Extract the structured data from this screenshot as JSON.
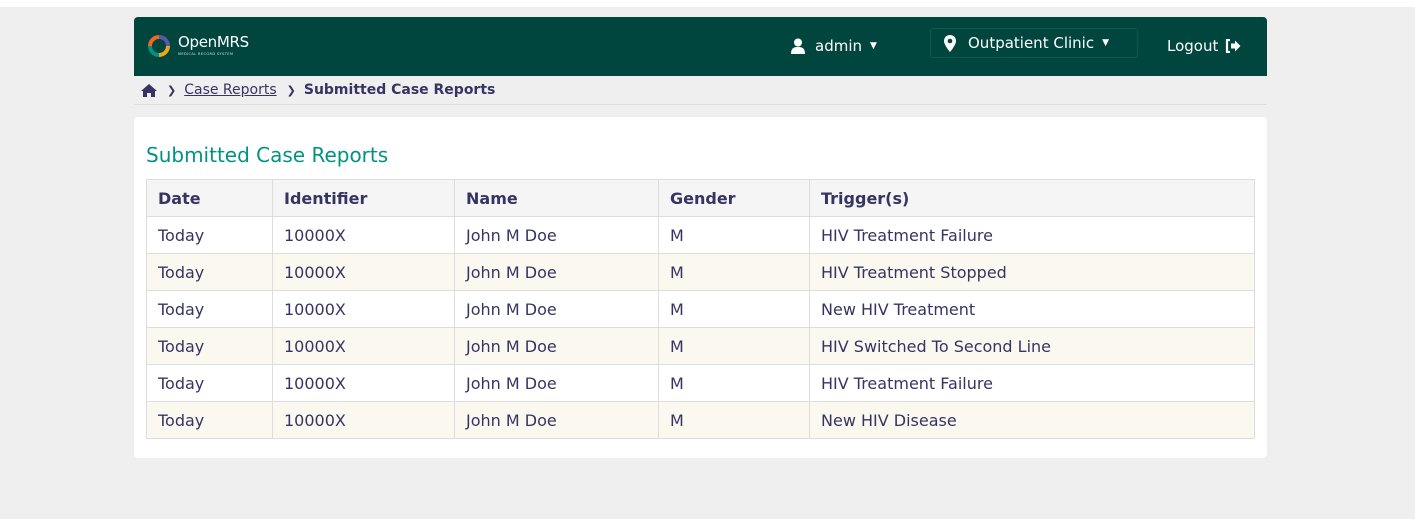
{
  "header": {
    "logo_name": "OpenMRS",
    "logo_subtitle": "MEDICAL RECORD SYSTEM",
    "user": "admin",
    "location": "Outpatient Clinic",
    "logout_label": "Logout"
  },
  "breadcrumb": {
    "home_icon": "home-icon",
    "link": "Case Reports",
    "current": "Submitted Case Reports"
  },
  "main": {
    "title": "Submitted Case Reports",
    "columns": [
      "Date",
      "Identifier",
      "Name",
      "Gender",
      "Trigger(s)"
    ],
    "rows": [
      [
        "Today",
        "10000X",
        "John M Doe",
        "M",
        "HIV Treatment Failure"
      ],
      [
        "Today",
        "10000X",
        "John M Doe",
        "M",
        "HIV Treatment Stopped"
      ],
      [
        "Today",
        "10000X",
        "John M Doe",
        "M",
        "New HIV Treatment"
      ],
      [
        "Today",
        "10000X",
        "John M Doe",
        "M",
        "HIV Switched To Second Line"
      ],
      [
        "Today",
        "10000X",
        "John M Doe",
        "M",
        "HIV Treatment Failure"
      ],
      [
        "Today",
        "10000X",
        "John M Doe",
        "M",
        "New HIV Disease"
      ]
    ]
  },
  "colors": {
    "header_bg": "#00463f",
    "title": "#009384",
    "text": "#363463",
    "stripe": "#fbf9ef",
    "page_bg": "#efefef"
  }
}
